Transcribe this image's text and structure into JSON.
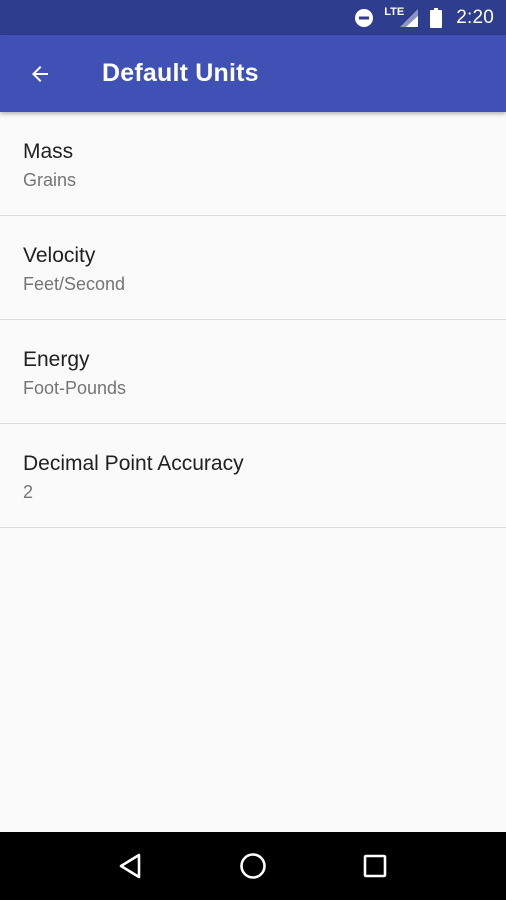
{
  "status_bar": {
    "network_label": "LTE",
    "time": "2:20",
    "icons": [
      "do-not-disturb-icon",
      "lte-signal-icon",
      "battery-icon"
    ]
  },
  "app_bar": {
    "title": "Default Units",
    "back_icon": "arrow-back-icon",
    "background_color": "#3f51b5",
    "status_color": "#2f3d8f"
  },
  "preferences": [
    {
      "title": "Mass",
      "summary": "Grains"
    },
    {
      "title": "Velocity",
      "summary": "Feet/Second"
    },
    {
      "title": "Energy",
      "summary": "Foot-Pounds"
    },
    {
      "title": "Decimal Point Accuracy",
      "summary": "2"
    }
  ],
  "nav_bar": {
    "icons": [
      "back-triangle-icon",
      "home-circle-icon",
      "recents-square-icon"
    ]
  }
}
